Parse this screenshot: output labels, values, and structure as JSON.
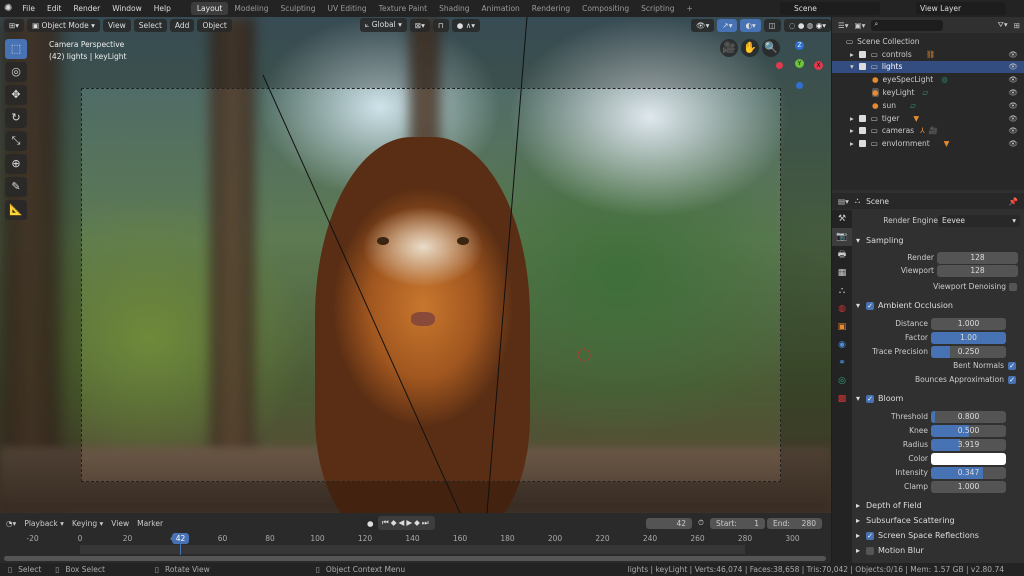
{
  "topbar": {
    "menus": [
      "File",
      "Edit",
      "Render",
      "Window",
      "Help"
    ],
    "workspaces": [
      "Layout",
      "Modeling",
      "Sculpting",
      "UV Editing",
      "Texture Paint",
      "Shading",
      "Animation",
      "Rendering",
      "Compositing",
      "Scripting"
    ],
    "active_workspace": "Layout",
    "add": "+",
    "scene": "Scene",
    "view_layer": "View Layer"
  },
  "viewport": {
    "mode": "Object Mode",
    "menus": [
      "View",
      "Select",
      "Add",
      "Object"
    ],
    "orientation": "Global",
    "overlay_title": "Camera Perspective",
    "overlay_sub": "(42) lights | keyLight",
    "gizmo": {
      "z": "Z",
      "y": "Y",
      "x": "X"
    }
  },
  "outliner": {
    "root": "Scene Collection",
    "items": [
      {
        "name": "controls",
        "level": 0,
        "expanded": false,
        "selected": false
      },
      {
        "name": "lights",
        "level": 0,
        "expanded": true,
        "selected": true
      },
      {
        "name": "eyeSpecLight",
        "level": 1
      },
      {
        "name": "keyLight",
        "level": 1
      },
      {
        "name": "sun",
        "level": 1
      },
      {
        "name": "tiger",
        "level": 0,
        "expanded": false
      },
      {
        "name": "cameras",
        "level": 0,
        "expanded": false
      },
      {
        "name": "envlornment",
        "level": 0,
        "expanded": false
      }
    ]
  },
  "properties": {
    "context": "Scene",
    "render_engine_label": "Render Engine",
    "render_engine": "Eevee",
    "sampling": {
      "title": "Sampling",
      "render_label": "Render",
      "render": "128",
      "viewport_label": "Viewport",
      "viewport": "128",
      "denoise_label": "Viewport Denoising",
      "denoise": false
    },
    "ao": {
      "title": "Ambient Occlusion",
      "enabled": true,
      "distance_label": "Distance",
      "distance": "1.000",
      "factor_label": "Factor",
      "factor": "1.00",
      "factor_fill": 1.0,
      "trace_label": "Trace Precision",
      "trace": "0.250",
      "trace_fill": 0.25,
      "bent_label": "Bent Normals",
      "bent": true,
      "bounces_label": "Bounces Approximation",
      "bounces": true
    },
    "bloom": {
      "title": "Bloom",
      "enabled": true,
      "threshold_label": "Threshold",
      "threshold": "0.800",
      "threshold_fill": 0.05,
      "knee_label": "Knee",
      "knee": "0.500",
      "knee_fill": 0.5,
      "radius_label": "Radius",
      "radius": "3.919",
      "radius_fill": 0.39,
      "color_label": "Color",
      "color": "#ffffff",
      "intensity_label": "Intensity",
      "intensity": "0.347",
      "intensity_fill": 0.69,
      "clamp_label": "Clamp",
      "clamp": "1.000"
    },
    "collapsed": [
      {
        "title": "Depth of Field"
      },
      {
        "title": "Subsurface Scattering"
      },
      {
        "title": "Screen Space Reflections",
        "checkbox": true,
        "checked": true
      },
      {
        "title": "Motion Blur",
        "checkbox": true,
        "checked": false
      }
    ]
  },
  "timeline": {
    "menus": [
      "Playback",
      "Keying",
      "View",
      "Marker"
    ],
    "current_frame": "42",
    "start_label": "Start:",
    "start": "1",
    "end_label": "End:",
    "end": "280",
    "ticks": [
      "-20",
      "0",
      "20",
      "40",
      "60",
      "80",
      "100",
      "120",
      "140",
      "160",
      "180",
      "200",
      "220",
      "240",
      "260",
      "280",
      "300"
    ]
  },
  "status": {
    "select": "Select",
    "box_select": "Box Select",
    "rotate": "Rotate View",
    "context_menu": "Object Context Menu",
    "info": "lights | keyLight | Verts:46,074 | Faces:38,658 | Tris:70,042 | Objects:0/16 | Mem: 1.57 GB | v2.80.74"
  },
  "colors": {
    "accent": "#4772b3",
    "selection": "#334d80",
    "object_orange": "#e8892f",
    "light_green": "#2fa87a"
  }
}
